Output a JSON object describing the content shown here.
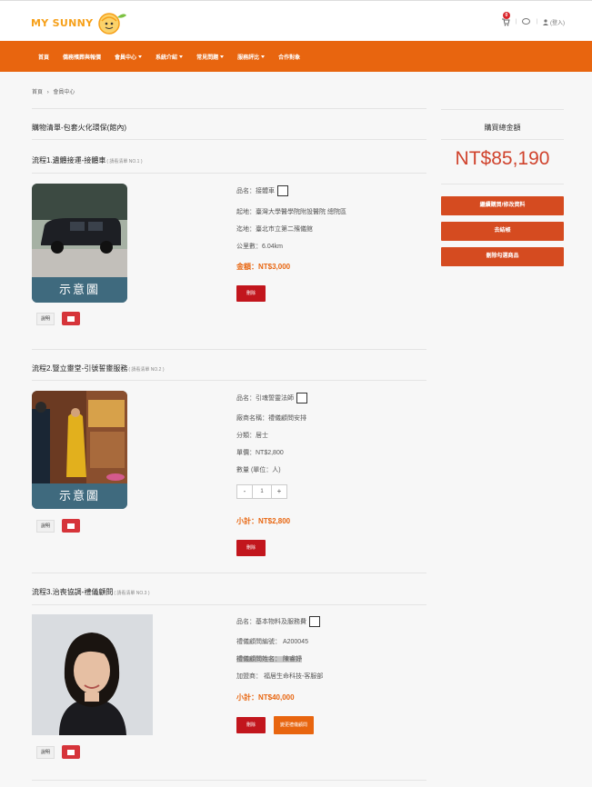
{
  "header": {
    "logo_text": "MY SUNNY",
    "cart_count": "0",
    "login_label": "(登入)"
  },
  "nav": {
    "items": [
      {
        "label": "首頁",
        "caret": false
      },
      {
        "label": "僑務殯葬與報價",
        "caret": false
      },
      {
        "label": "會員中心",
        "caret": true
      },
      {
        "label": "系統介紹",
        "caret": true
      },
      {
        "label": "常見問題",
        "caret": true
      },
      {
        "label": "服務評比",
        "caret": true
      },
      {
        "label": "合作對象",
        "caret": false
      }
    ]
  },
  "breadcrumb": {
    "home": "首頁",
    "separator": "›",
    "current": "會員中心"
  },
  "main": {
    "heading": "購物清單-包套火化環保(館內)",
    "steps": [
      {
        "title": "流程1.遺體接運-接體車",
        "note": "( 請看清單 NO.1 )",
        "image_caption": "示意圖",
        "desc_label": "說明",
        "item_name": "品名：接體車",
        "lines": [
          "起地：臺灣大學醫學院附設醫院 總院區",
          "迄地：臺北市立第二殯儀館",
          "公里數：6.04km"
        ],
        "amount": "金額：NT$3,000",
        "delete_label": "刪除"
      },
      {
        "title": "流程2.豎立靈堂-引號誓靈服務",
        "note": "( 請看清單 NO.2 )",
        "image_caption": "示意圖",
        "desc_label": "說明",
        "item_name": "品名：引魂誓靈法師",
        "lines": [
          "廠商名稱：禮儀顧問安排",
          "分類：居士",
          "單價：NT$2,800",
          "數量 (單位：人)"
        ],
        "quantity": "1",
        "minus": "-",
        "plus": "+",
        "amount": "小計：NT$2,800",
        "delete_label": "刪除"
      },
      {
        "title": "流程3.治喪協調-禮儀顧問",
        "note": "( 請看清單 NO.3 )",
        "desc_label": "說明",
        "item_name": "品名：基本物料及服務費",
        "lines": [
          "禮儀顧問編號： A200045",
          "禮儀顧問姓名： 陳睿妤",
          "加盟商： 福居生命科技-客服部"
        ],
        "amount": "小計：NT$40,000",
        "delete_label": "刪除",
        "change_label": "變更禮儀顧問"
      }
    ]
  },
  "sidebar": {
    "title": "購買總金額",
    "total": "NT$85,190",
    "buttons": [
      "繼續購買/修改資料",
      "去結帳",
      "刪除勾選商品"
    ]
  },
  "colors": {
    "nav": "#e8650f",
    "accent": "#d0432d",
    "delete": "#c2161d"
  }
}
